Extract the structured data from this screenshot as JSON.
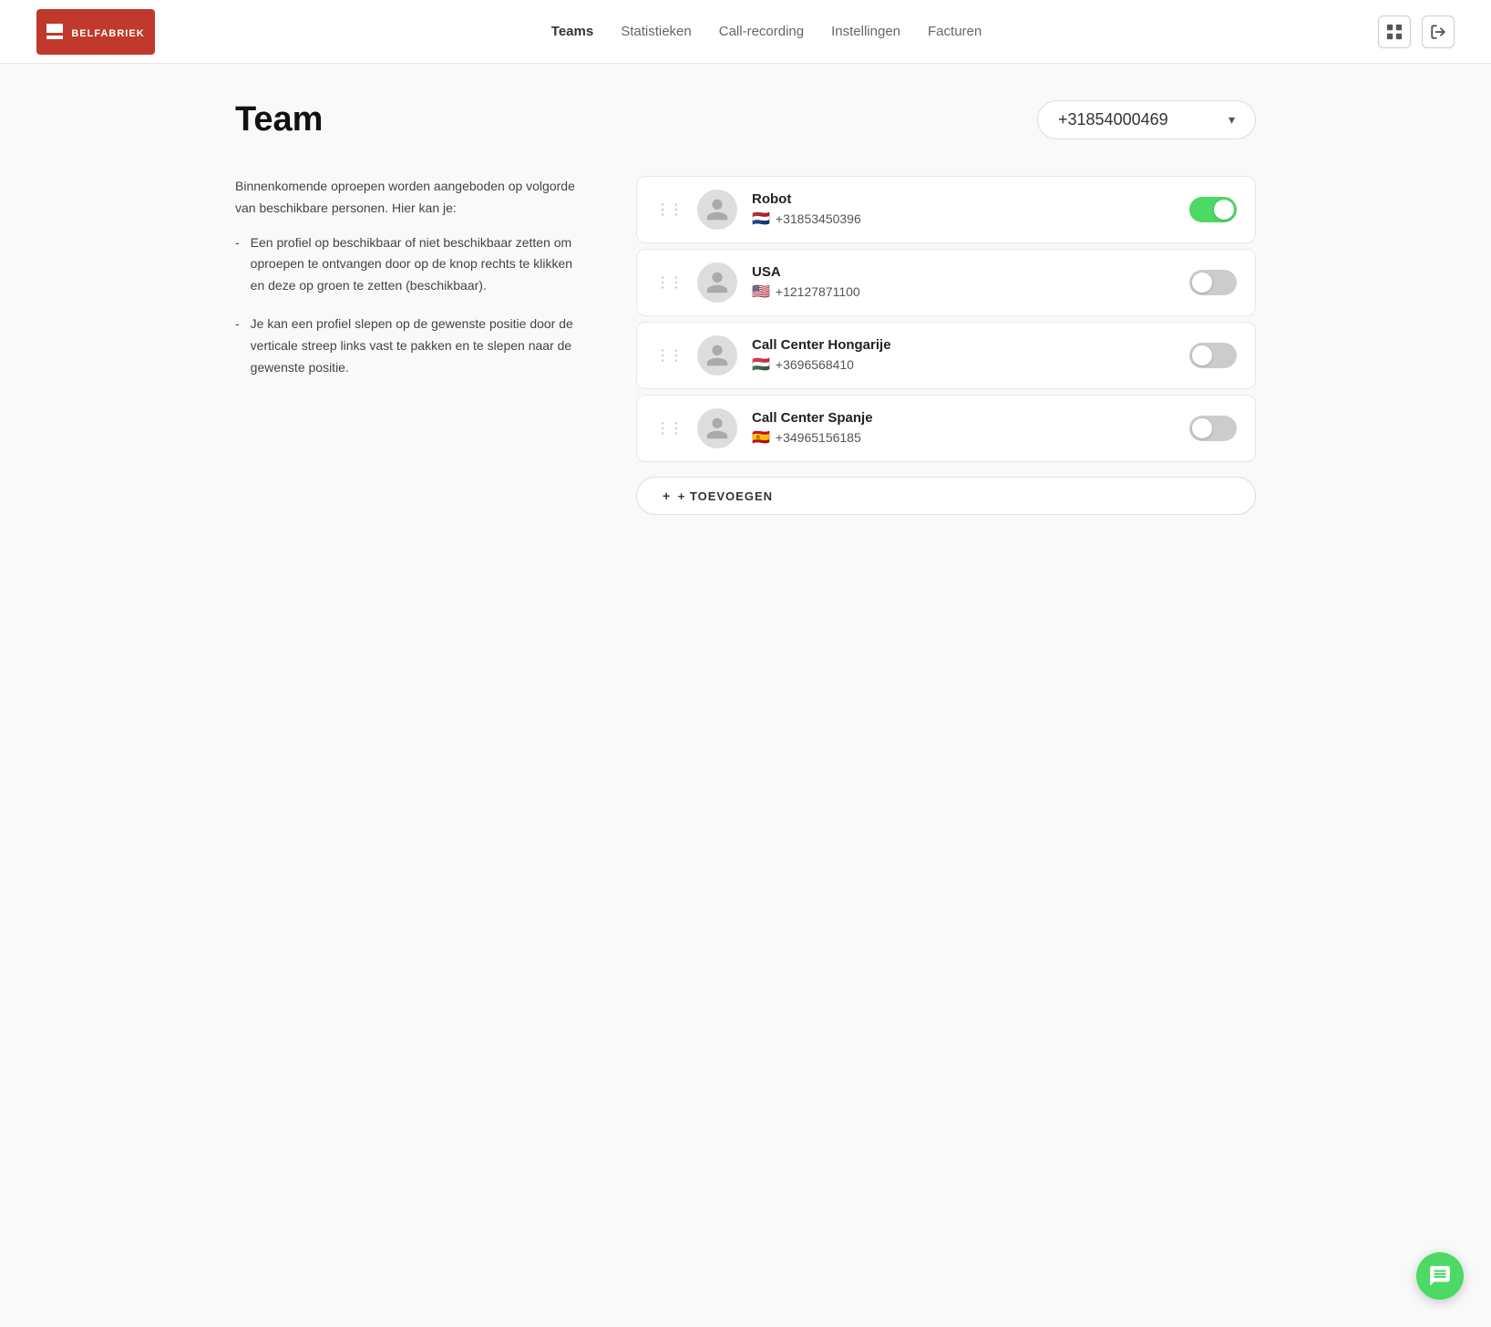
{
  "header": {
    "logo_alt": "Belfabriek",
    "nav": [
      {
        "label": "Teams",
        "active": true
      },
      {
        "label": "Statistieken",
        "active": false
      },
      {
        "label": "Call-recording",
        "active": false
      },
      {
        "label": "Instellingen",
        "active": false
      },
      {
        "label": "Facturen",
        "active": false
      }
    ]
  },
  "page": {
    "title": "Team",
    "phone_number": "+31854000469"
  },
  "description": {
    "intro": "Binnenkomende oproepen worden aangeboden op volgorde van beschikbare personen. Hier kan je:",
    "items": [
      "Een profiel op beschikbaar of niet beschikbaar zetten om oproepen te ontvangen door op de knop rechts te klikken en deze op groen te zetten (beschikbaar).",
      "Je kan een profiel slepen op de gewenste positie door de verticale streep links vast te pakken en te slepen naar de gewenste positie."
    ]
  },
  "team_members": [
    {
      "name": "Robot",
      "phone": "+31853450396",
      "flag": "🇳🇱",
      "enabled": true
    },
    {
      "name": "USA",
      "phone": "+12127871100",
      "flag": "🇺🇸",
      "enabled": false
    },
    {
      "name": "Call Center Hongarije",
      "phone": "+3696568410",
      "flag": "🇭🇺",
      "enabled": false
    },
    {
      "name": "Call Center Spanje",
      "phone": "+34965156185",
      "flag": "🇪🇸",
      "enabled": false
    }
  ],
  "add_button": "+ TOEVOEGEN",
  "colors": {
    "accent": "#c0392b",
    "toggle_on": "#4cd964"
  }
}
